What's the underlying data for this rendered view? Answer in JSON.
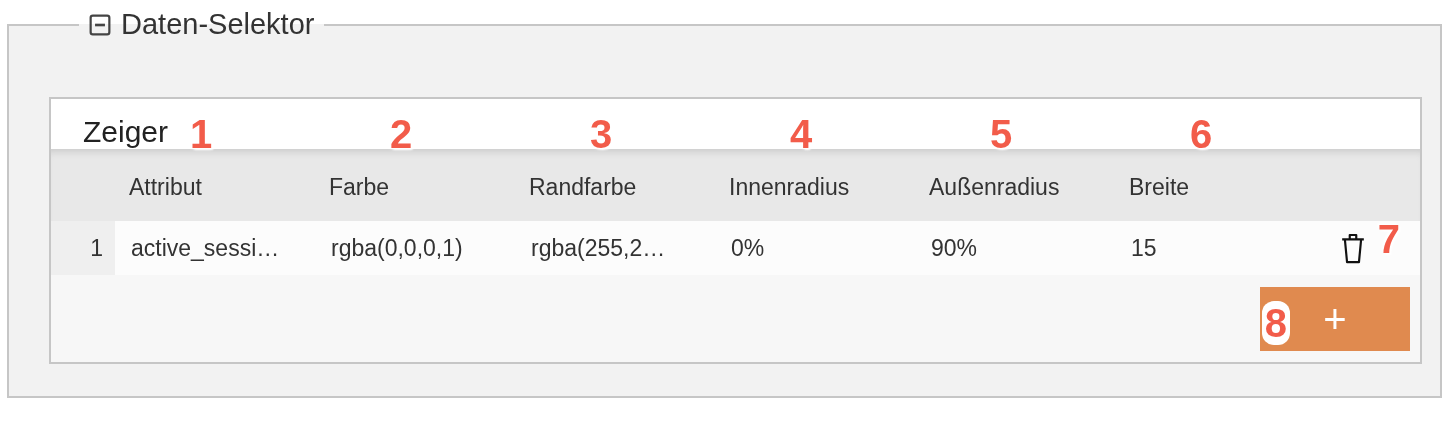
{
  "panel": {
    "title": "Daten-Selektor",
    "collapsed": false
  },
  "section": {
    "title": "Zeiger"
  },
  "table": {
    "columns": [
      {
        "label": "Attribut",
        "callout": "1"
      },
      {
        "label": "Farbe",
        "callout": "2"
      },
      {
        "label": "Randfarbe",
        "callout": "3"
      },
      {
        "label": "Innenradius",
        "callout": "4"
      },
      {
        "label": "Außenradius",
        "callout": "5"
      },
      {
        "label": "Breite",
        "callout": "6"
      }
    ],
    "rows": [
      {
        "index": "1",
        "cells": [
          "active_sessi…",
          "rgba(0,0,0,1)",
          "rgba(255,2…",
          "0%",
          "90%",
          "15"
        ],
        "delete_callout": "7"
      }
    ]
  },
  "add_button": {
    "label": "+",
    "callout": "8"
  }
}
